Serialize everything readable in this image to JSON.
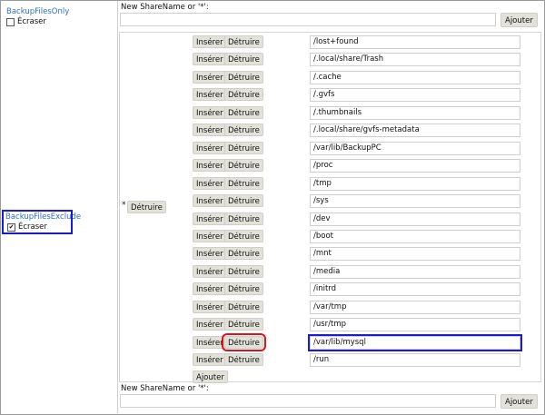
{
  "left": {
    "backup_files_only": {
      "label": "BackupFilesOnly",
      "overwrite": "Écraser",
      "checked": false
    },
    "backup_files_exclude": {
      "label": "BackupFilesExclude",
      "overwrite": "Écraser",
      "checked": true
    }
  },
  "top_share": {
    "label": "New ShareName or '*':",
    "value": "",
    "add_label": "Ajouter"
  },
  "exclude": {
    "share_name": "*",
    "destroy_label": "Détruire",
    "insert_label": "Insérer",
    "entry_destroy_label": "Détruire",
    "add_label": "Ajouter",
    "entries": [
      "/lost+found",
      "/.local/share/Trash",
      "/.cache",
      "/.gvfs",
      "/.thumbnails",
      "/.local/share/gvfs-metadata",
      "/var/lib/BackupPC",
      "/proc",
      "/tmp",
      "/sys",
      "/dev",
      "/boot",
      "/mnt",
      "/media",
      "/initrd",
      "/var/tmp",
      "/usr/tmp",
      "/var/lib/mysql",
      "/run"
    ]
  },
  "bottom_share": {
    "label": "New ShareName or '*':",
    "value": "",
    "add_label": "Ajouter"
  },
  "colors": {
    "link": "#2c6fd0",
    "button_bg": "#e2e2da",
    "highlight_red": "#e3101a",
    "highlight_blue": "#1b1bd6"
  }
}
